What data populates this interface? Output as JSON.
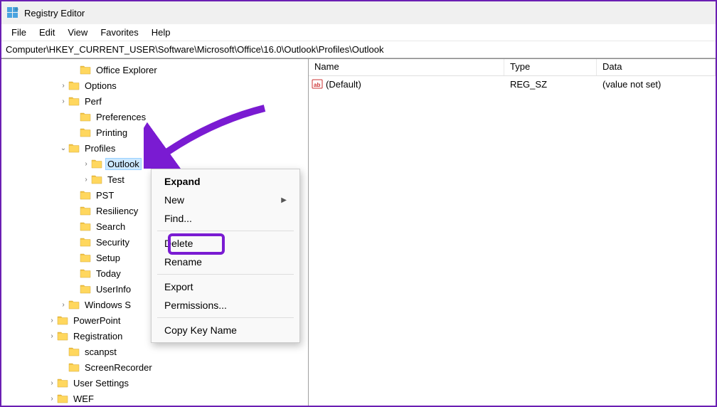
{
  "window": {
    "title": "Registry Editor"
  },
  "menubar": [
    "File",
    "Edit",
    "View",
    "Favorites",
    "Help"
  ],
  "addressbar": "Computer\\HKEY_CURRENT_USER\\Software\\Microsoft\\Office\\16.0\\Outlook\\Profiles\\Outlook",
  "tree": [
    {
      "indent": 96,
      "toggle": "",
      "label": "Office Explorer"
    },
    {
      "indent": 80,
      "toggle": ">",
      "label": "Options"
    },
    {
      "indent": 80,
      "toggle": ">",
      "label": "Perf"
    },
    {
      "indent": 96,
      "toggle": "",
      "label": "Preferences"
    },
    {
      "indent": 96,
      "toggle": "",
      "label": "Printing"
    },
    {
      "indent": 80,
      "toggle": "v",
      "label": "Profiles"
    },
    {
      "indent": 112,
      "toggle": ">",
      "label": "Outlook",
      "selected": true
    },
    {
      "indent": 112,
      "toggle": ">",
      "label": "Test"
    },
    {
      "indent": 96,
      "toggle": "",
      "label": "PST"
    },
    {
      "indent": 96,
      "toggle": "",
      "label": "Resiliency"
    },
    {
      "indent": 96,
      "toggle": "",
      "label": "Search"
    },
    {
      "indent": 96,
      "toggle": "",
      "label": "Security"
    },
    {
      "indent": 96,
      "toggle": "",
      "label": "Setup"
    },
    {
      "indent": 96,
      "toggle": "",
      "label": "Today"
    },
    {
      "indent": 96,
      "toggle": "",
      "label": "UserInfo"
    },
    {
      "indent": 80,
      "toggle": ">",
      "label": "Windows S"
    },
    {
      "indent": 64,
      "toggle": ">",
      "label": "PowerPoint"
    },
    {
      "indent": 64,
      "toggle": ">",
      "label": "Registration"
    },
    {
      "indent": 80,
      "toggle": "",
      "label": "scanpst"
    },
    {
      "indent": 80,
      "toggle": "",
      "label": "ScreenRecorder"
    },
    {
      "indent": 64,
      "toggle": ">",
      "label": "User Settings"
    },
    {
      "indent": 64,
      "toggle": ">",
      "label": "WEF"
    }
  ],
  "list": {
    "headers": {
      "name": "Name",
      "type": "Type",
      "data": "Data"
    },
    "rows": [
      {
        "name": "(Default)",
        "type": "REG_SZ",
        "data": "(value not set)"
      }
    ]
  },
  "context_menu": {
    "expand": "Expand",
    "new": "New",
    "find": "Find...",
    "delete": "Delete",
    "rename": "Rename",
    "export": "Export",
    "permissions": "Permissions...",
    "copy_key": "Copy Key Name"
  }
}
